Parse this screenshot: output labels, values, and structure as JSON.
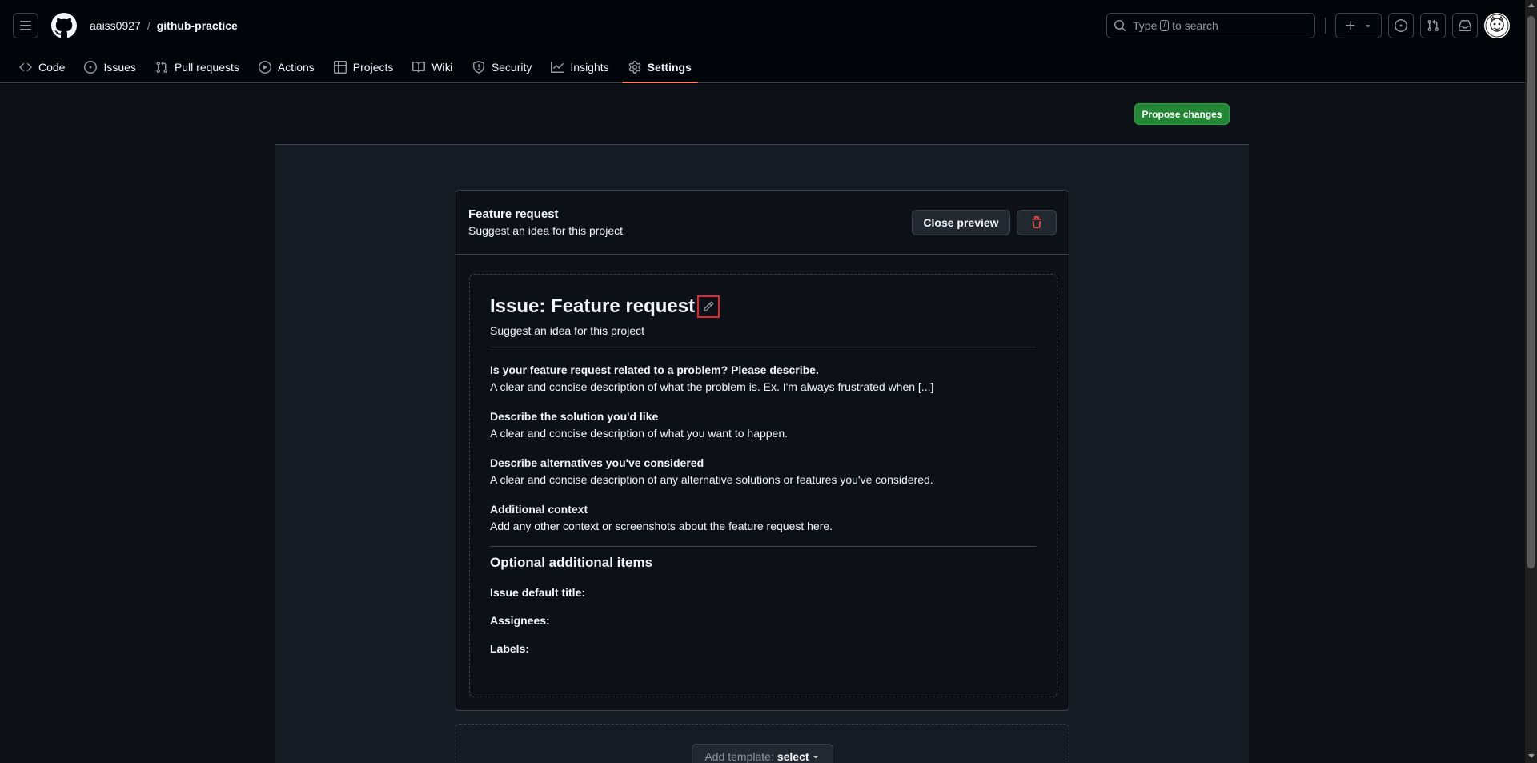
{
  "header": {
    "owner": "aaiss0927",
    "separator": "/",
    "repo": "github-practice",
    "search_prefix": "Type",
    "search_key": "/",
    "search_suffix": "to search"
  },
  "repo_nav": [
    {
      "label": "Code",
      "icon": "code-icon"
    },
    {
      "label": "Issues",
      "icon": "issue-opened-icon"
    },
    {
      "label": "Pull requests",
      "icon": "git-pull-request-icon"
    },
    {
      "label": "Actions",
      "icon": "play-icon"
    },
    {
      "label": "Projects",
      "icon": "table-icon"
    },
    {
      "label": "Wiki",
      "icon": "book-icon"
    },
    {
      "label": "Security",
      "icon": "shield-icon"
    },
    {
      "label": "Insights",
      "icon": "graph-icon"
    },
    {
      "label": "Settings",
      "icon": "gear-icon",
      "active": true
    }
  ],
  "propose_label": "Propose changes",
  "template": {
    "name": "Feature request",
    "about": "Suggest an idea for this project",
    "close_preview_label": "Close preview"
  },
  "preview": {
    "title": "Issue: Feature request",
    "about": "Suggest an idea for this project",
    "sections": [
      {
        "heading": "Is your feature request related to a problem? Please describe.",
        "body": "A clear and concise description of what the problem is. Ex. I'm always frustrated when [...]"
      },
      {
        "heading": "Describe the solution you'd like",
        "body": "A clear and concise description of what you want to happen."
      },
      {
        "heading": "Describe alternatives you've considered",
        "body": "A clear and concise description of any alternative solutions or features you've considered."
      },
      {
        "heading": "Additional context",
        "body": "Add any other context or screenshots about the feature request here."
      }
    ],
    "optional_title": "Optional additional items",
    "default_title_label": "Issue default title:",
    "assignees_label": "Assignees:",
    "labels_label": "Labels:"
  },
  "add_template": {
    "label": "Add template:",
    "value": "select"
  },
  "colors": {
    "accent_green": "#238636",
    "active_underline": "#f78166",
    "danger": "#f85149",
    "highlight_box": "#e5252a"
  }
}
